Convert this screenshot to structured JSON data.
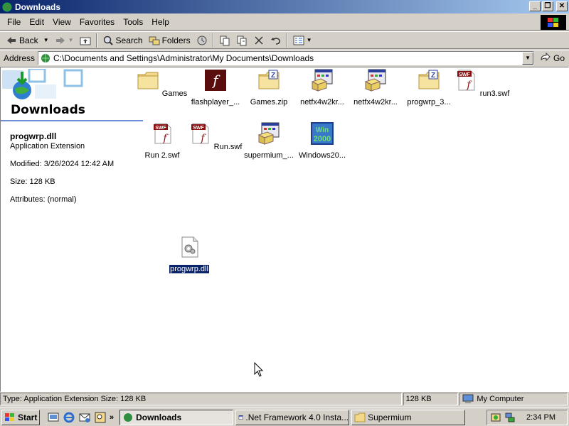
{
  "window": {
    "title": "Downloads"
  },
  "menu": [
    "File",
    "Edit",
    "View",
    "Favorites",
    "Tools",
    "Help"
  ],
  "toolbar": {
    "back": "Back",
    "search": "Search",
    "folders": "Folders"
  },
  "address": {
    "label": "Address",
    "path": "C:\\Documents and Settings\\Administrator\\My Documents\\Downloads",
    "go": "Go"
  },
  "folder_title": "Downloads",
  "details": {
    "name": "progwrp.dll",
    "type": "Application Extension",
    "modified": "Modified: 3/26/2024 12:42 AM",
    "size": "Size: 128 KB",
    "attributes": "Attributes: (normal)"
  },
  "files": [
    {
      "label": "Games",
      "icon": "folder-icon"
    },
    {
      "label": "flashplayer_...",
      "icon": "flash-player-icon"
    },
    {
      "label": "Games.zip",
      "icon": "zip-folder-icon"
    },
    {
      "label": "netfx4w2kr...",
      "icon": "installer-icon"
    },
    {
      "label": "netfx4w2kr...",
      "icon": "installer-icon"
    },
    {
      "label": "progwrp_3...",
      "icon": "zip-folder-icon"
    },
    {
      "label": "run3.swf",
      "icon": "swf-icon"
    },
    {
      "label": "Run 2.swf",
      "icon": "swf-icon"
    },
    {
      "label": "Run.swf",
      "icon": "swf-icon"
    },
    {
      "label": "supermium_...",
      "icon": "installer-icon"
    },
    {
      "label": "Windows20...",
      "icon": "windows-2000-icon"
    },
    {
      "label": "progwrp.dll",
      "icon": "dll-icon",
      "selected": true
    }
  ],
  "status": {
    "text": "Type: Application Extension Size: 128 KB",
    "size": "128 KB",
    "zone": "My Computer"
  },
  "taskbar": {
    "start": "Start",
    "tasks": [
      {
        "label": "Downloads",
        "active": true
      },
      {
        "label": ".Net Framework 4.0 Insta...",
        "active": false
      },
      {
        "label": "Supermium",
        "active": false
      }
    ],
    "clock": "2:34 PM"
  },
  "colors": {
    "titlebar_start": "#0a246a",
    "titlebar_end": "#a6caf0",
    "selection": "#0a246a",
    "face": "#d4d0c8"
  }
}
